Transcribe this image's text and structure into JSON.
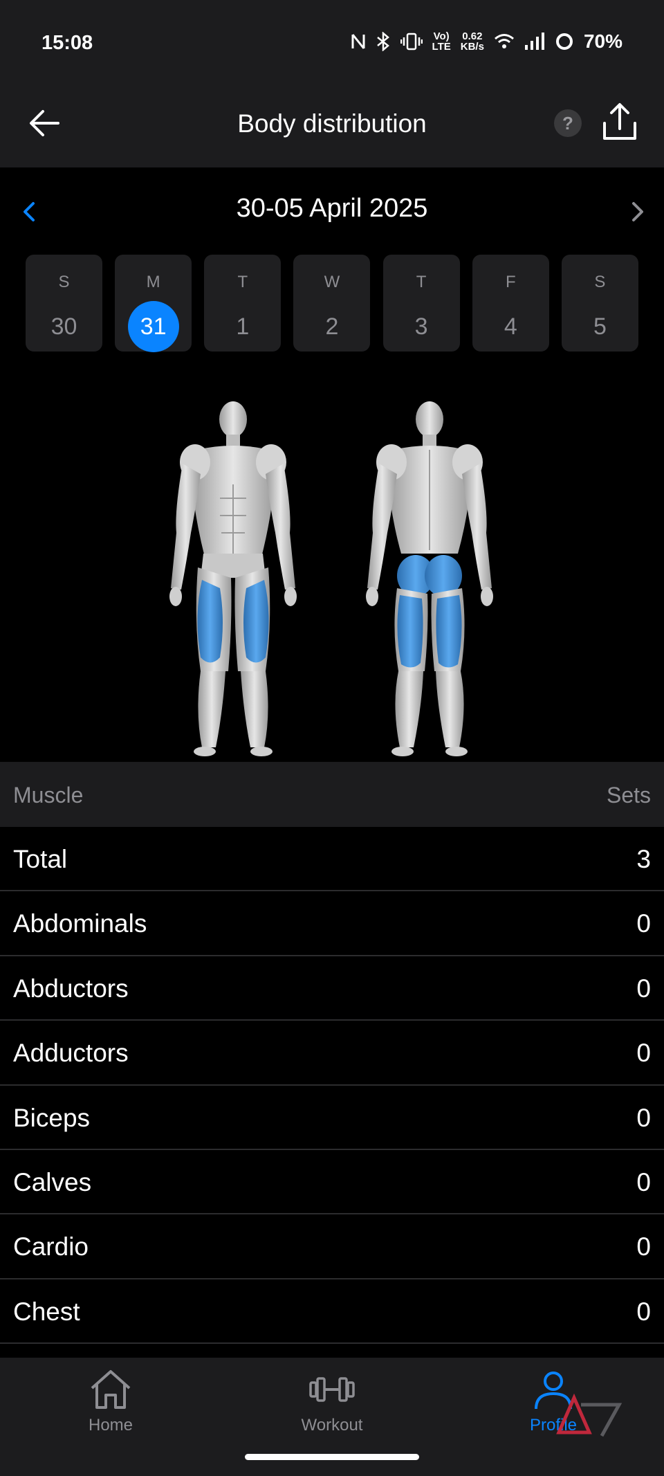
{
  "status_bar": {
    "time": "15:08",
    "net_speed_top": "0.62",
    "net_speed_bottom": "KB/s",
    "volte_top": "Vo)",
    "volte_bottom": "LTE",
    "battery": "70%",
    "icons": [
      "nfc-icon",
      "bluetooth-icon",
      "vibrate-icon",
      "volte-icon",
      "wifi-icon",
      "signal-icon",
      "battery-ring-icon"
    ]
  },
  "header": {
    "title": "Body distribution",
    "help_label": "?"
  },
  "week": {
    "range": "30-05 April 2025",
    "days": [
      {
        "letter": "S",
        "num": "30"
      },
      {
        "letter": "M",
        "num": "31"
      },
      {
        "letter": "T",
        "num": "1"
      },
      {
        "letter": "W",
        "num": "2"
      },
      {
        "letter": "T",
        "num": "3"
      },
      {
        "letter": "F",
        "num": "4"
      },
      {
        "letter": "S",
        "num": "5"
      }
    ],
    "selected_index": 1
  },
  "colors": {
    "accent": "#0a84ff",
    "muscle_highlight": "#3a8fd8",
    "background": "#000000",
    "surface": "#1c1c1e"
  },
  "table": {
    "col_muscle": "Muscle",
    "col_sets": "Sets",
    "rows": [
      {
        "name": "Total",
        "sets": "3"
      },
      {
        "name": "Abdominals",
        "sets": "0"
      },
      {
        "name": "Abductors",
        "sets": "0"
      },
      {
        "name": "Adductors",
        "sets": "0"
      },
      {
        "name": "Biceps",
        "sets": "0"
      },
      {
        "name": "Calves",
        "sets": "0"
      },
      {
        "name": "Cardio",
        "sets": "0"
      },
      {
        "name": "Chest",
        "sets": "0"
      }
    ]
  },
  "nav": {
    "home": "Home",
    "workout": "Workout",
    "profile": "Profile",
    "active": "profile"
  }
}
